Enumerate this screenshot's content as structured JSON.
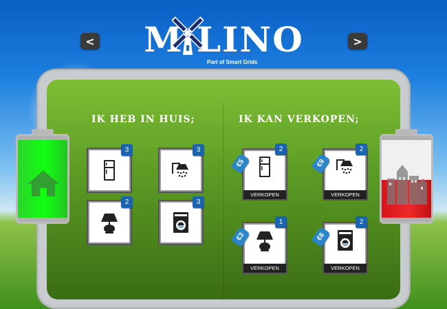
{
  "header": {
    "logo_text": "M LINO",
    "logo_subtitle": "Part of Smart Grids",
    "prev_label": "<",
    "next_label": ">"
  },
  "left": {
    "heading": "IK HEB IN HUIS;",
    "items": [
      {
        "icon": "fridge-icon",
        "count": "3"
      },
      {
        "icon": "shower-icon",
        "count": "3"
      },
      {
        "icon": "lamp-icon",
        "count": "2"
      },
      {
        "icon": "washing-machine-icon",
        "count": "3"
      }
    ]
  },
  "right": {
    "heading": "IK KAN VERKOPEN;",
    "sell_label": "VERKOPEN",
    "items": [
      {
        "icon": "fridge-icon",
        "count": "2",
        "price": "€5"
      },
      {
        "icon": "shower-icon",
        "count": "2",
        "price": "€9"
      },
      {
        "icon": "lamp-icon",
        "count": "1",
        "price": "€3"
      },
      {
        "icon": "washing-machine-icon",
        "count": "2",
        "price": "€6"
      }
    ]
  },
  "batteries": {
    "home": {
      "icon": "house-icon",
      "fill_color": "#11ff11",
      "level": 1.0
    },
    "city": {
      "icon": "city-icon",
      "fill_color": "#e41e22",
      "level": 0.5
    }
  }
}
